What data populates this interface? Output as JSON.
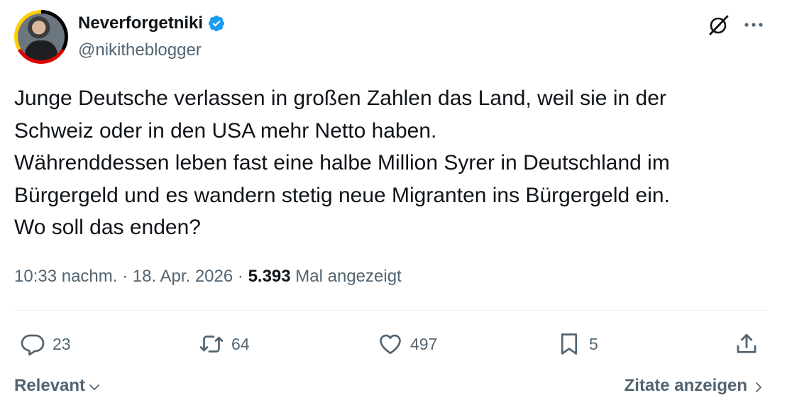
{
  "author": {
    "display_name": "Neverforgetniki",
    "handle": "@nikitheblogger",
    "verified": true,
    "verified_color": "#1d9bf0"
  },
  "tweet": {
    "text": "Junge Deutsche verlassen in großen Zahlen das Land, weil sie in der\nSchweiz oder in den USA mehr Netto haben.\nWährenddessen leben fast eine halbe Million Syrer in Deutschland im\nBürgergeld und es wandern stetig neue Migranten ins Bürgergeld ein.\nWo soll das enden?",
    "time": "10:33 nachm.",
    "separator": " · ",
    "date": "18. Apr. 2026",
    "views": "5.393",
    "views_label": "Mal angezeigt"
  },
  "actions": {
    "replies": "23",
    "reposts": "64",
    "likes": "497",
    "bookmarks": "5"
  },
  "icons": {
    "reply": "speech-bubble-icon",
    "repost": "repost-arrows-icon",
    "like": "heart-icon",
    "bookmark": "bookmark-icon",
    "share": "share-upload-icon",
    "grok": "grok-icon",
    "more": "more-dots-icon"
  },
  "footer": {
    "sort_label": "Relevant",
    "quotes_label": "Zitate anzeigen"
  },
  "colors": {
    "text_primary": "#0f1419",
    "text_secondary": "#536471",
    "divider": "#eff3f4"
  }
}
